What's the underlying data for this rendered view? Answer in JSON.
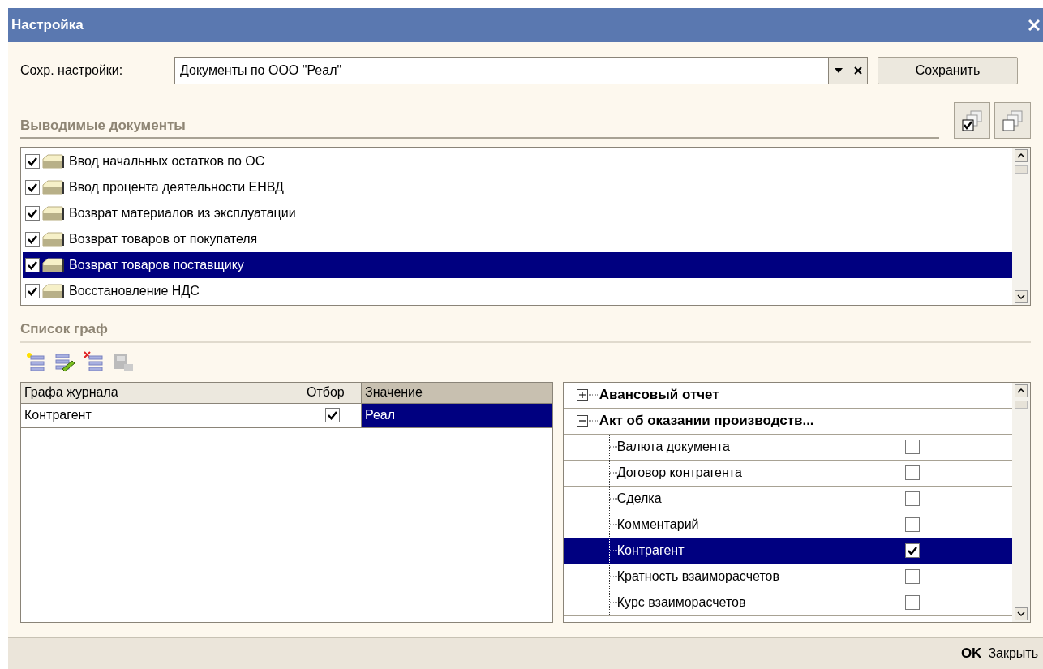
{
  "window": {
    "title": "Настройка"
  },
  "saved_settings": {
    "label": "Сохр. настройки:",
    "value": "Документы по ООО \"Реал\"",
    "save_button": "Сохранить"
  },
  "documents": {
    "title": "Выводимые документы",
    "items": [
      {
        "label": "Ввод начальных остатков по ОС",
        "checked": true,
        "selected": false
      },
      {
        "label": "Ввод процента деятельности ЕНВД",
        "checked": true,
        "selected": false
      },
      {
        "label": "Возврат материалов из эксплуатации",
        "checked": true,
        "selected": false
      },
      {
        "label": "Возврат товаров от покупателя",
        "checked": true,
        "selected": false
      },
      {
        "label": "Возврат товаров поставщику",
        "checked": true,
        "selected": true
      },
      {
        "label": "Восстановление НДС",
        "checked": true,
        "selected": false
      }
    ]
  },
  "columns_section": {
    "title": "Список граф",
    "table": {
      "columns": [
        "Графа журнала",
        "Отбор",
        "Значение"
      ],
      "rows": [
        {
          "column": "Контрагент",
          "filter": true,
          "value": "Реал",
          "selected": true
        }
      ]
    }
  },
  "fields_tree": [
    {
      "label": "Авансовый отчет",
      "expanded": false
    },
    {
      "label": "Акт об оказании производств...",
      "expanded": true,
      "children": [
        {
          "label": "Валюта документа",
          "checked": false,
          "selected": false
        },
        {
          "label": "Договор контрагента",
          "checked": false,
          "selected": false
        },
        {
          "label": "Сделка",
          "checked": false,
          "selected": false
        },
        {
          "label": "Комментарий",
          "checked": false,
          "selected": false
        },
        {
          "label": "Контрагент",
          "checked": true,
          "selected": true
        },
        {
          "label": "Кратность взаиморасчетов",
          "checked": false,
          "selected": false
        },
        {
          "label": "Курс взаиморасчетов",
          "checked": false,
          "selected": false
        }
      ]
    }
  ],
  "footer": {
    "ok": "OK",
    "close": "Закрыть"
  }
}
